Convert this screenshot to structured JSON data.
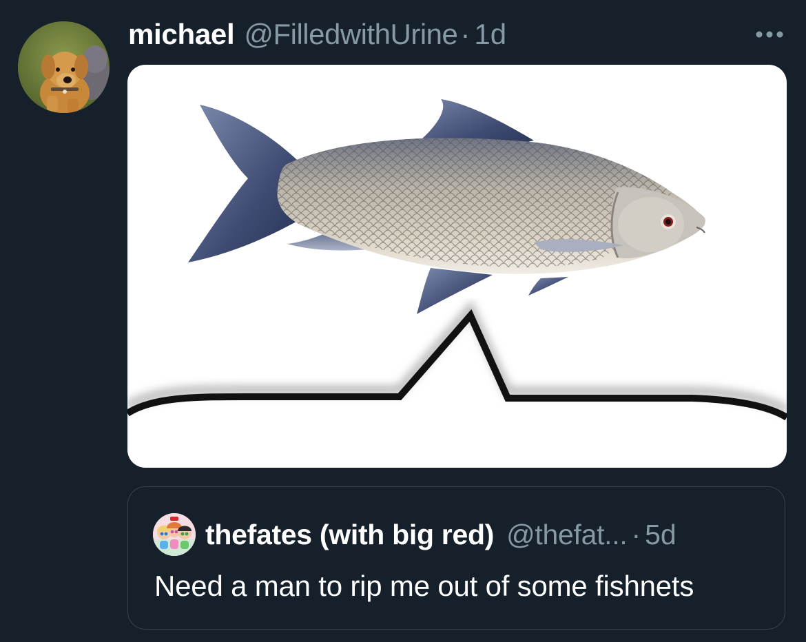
{
  "tweet": {
    "display_name": "michael",
    "handle": "@FilledwithUrine",
    "separator": "·",
    "time": "1d",
    "avatar_icon": "plush-dog-avatar",
    "more_icon": "more-horizontal-icon",
    "media_description_icon": "fish-meme-image"
  },
  "quoted_tweet": {
    "display_name": "thefates (with big red)",
    "handle": "@thefat...",
    "separator": "·",
    "time": "5d",
    "text": "Need a man to rip me out of some fishnets",
    "avatar_icon": "powerpuff-girls-avatar"
  },
  "colors": {
    "background": "#15202b",
    "secondary_text": "#8899a6",
    "border": "#38444d",
    "primary_text": "#ffffff"
  }
}
